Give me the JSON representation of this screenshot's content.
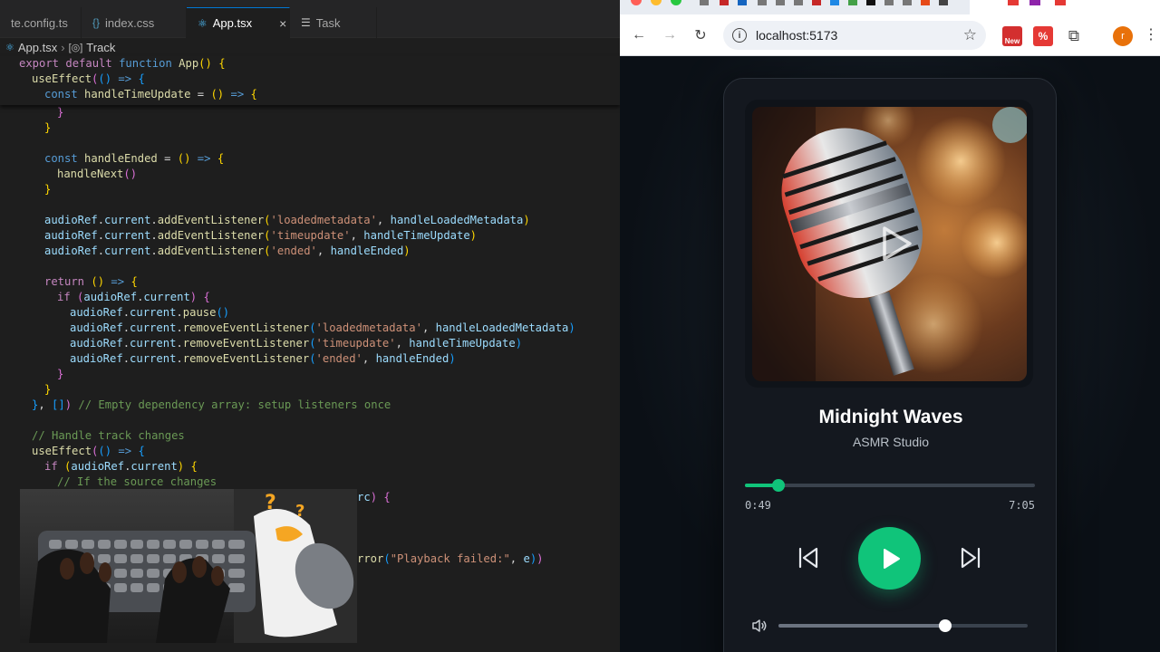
{
  "editor": {
    "tabs": [
      {
        "label": "te.config.ts",
        "icon": "typescript-icon"
      },
      {
        "label": "index.css",
        "icon": "css-braces-icon"
      },
      {
        "label": "App.tsx",
        "icon": "react-icon",
        "active": true
      },
      {
        "label": "Task",
        "icon": "task-list-icon"
      }
    ],
    "breadcrumb": {
      "file": "App.tsx",
      "symbol": "Track"
    }
  },
  "browser": {
    "url": "localhost:5173",
    "profile_initial": "r",
    "extension_badge": "New"
  },
  "player": {
    "title": "Midnight Waves",
    "artist": "ASMR Studio",
    "current_time": "0:49",
    "duration": "7:05",
    "progress_fraction": 0.115,
    "volume_fraction": 0.67,
    "accent_color": "#10c47a"
  }
}
